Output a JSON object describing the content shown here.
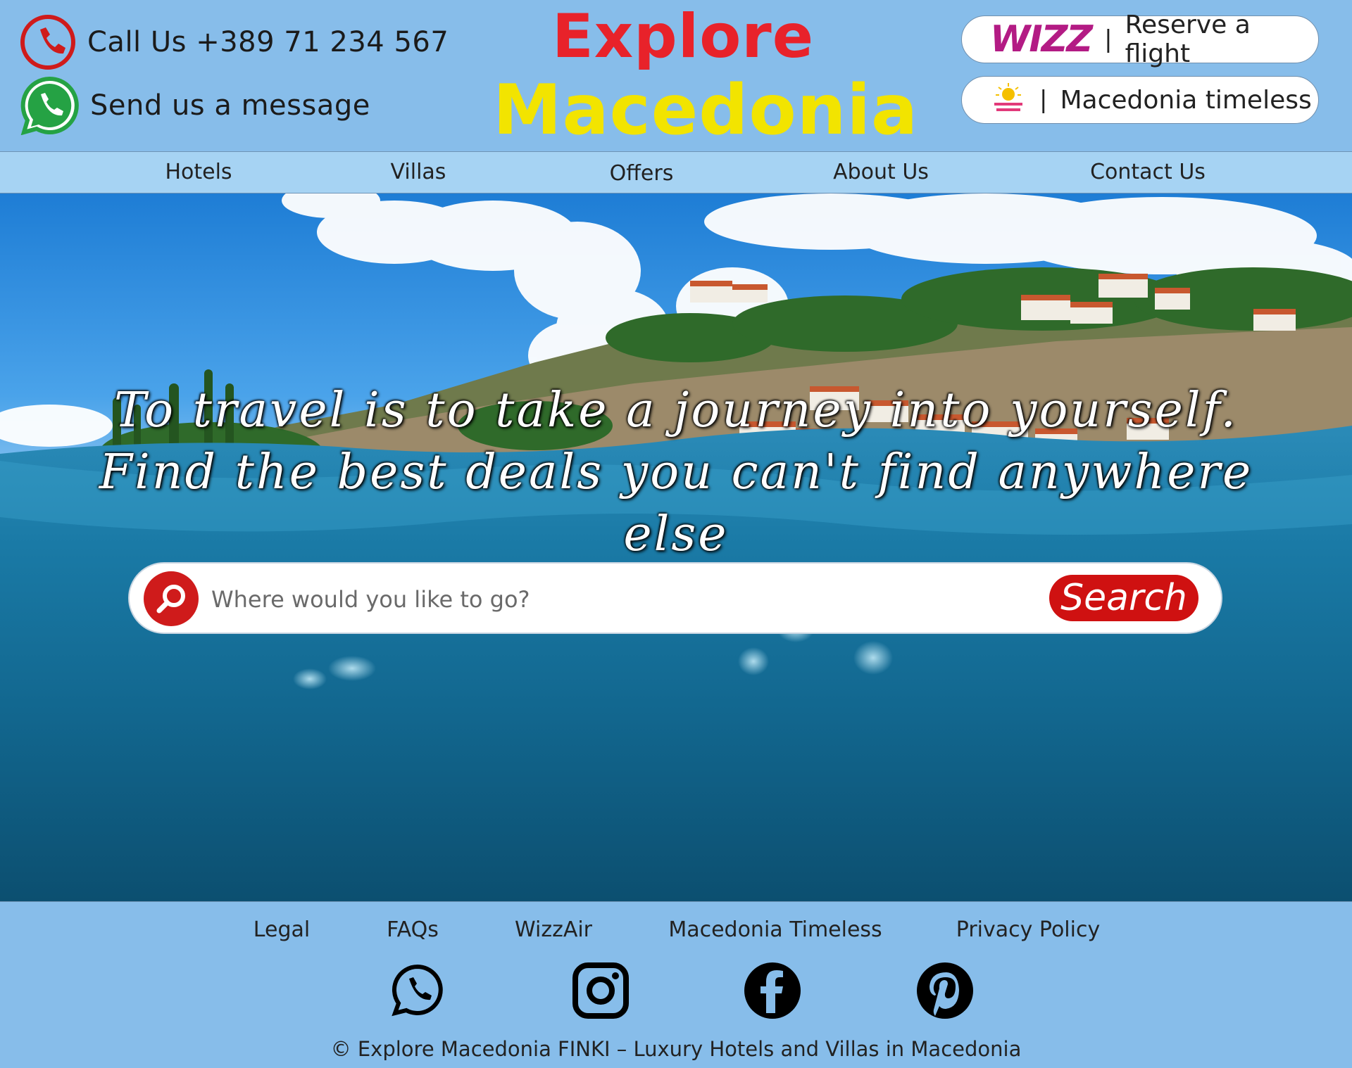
{
  "header": {
    "phone_text": "Call Us +389 71 234 567",
    "message_text": "Send us a message",
    "logo_line1": "Explore",
    "logo_line2": "Macedonia",
    "wizz_logo": "WIZZ",
    "pill_separator": "|",
    "reserve_flight": "Reserve a flight",
    "macedonia_timeless": "Macedonia timeless"
  },
  "nav": {
    "items": [
      {
        "label": "Hotels"
      },
      {
        "label": "Villas"
      },
      {
        "label": "Offers"
      },
      {
        "label": "About Us"
      },
      {
        "label": "Contact Us"
      }
    ]
  },
  "hero": {
    "tagline": "To travel is to take a journey into yourself. Find the best deals you can't find anywhere else",
    "search_placeholder": "Where would you like to go?",
    "search_button": "Search"
  },
  "footer": {
    "links": [
      {
        "label": "Legal"
      },
      {
        "label": "FAQs"
      },
      {
        "label": "WizzAir"
      },
      {
        "label": "Macedonia Timeless"
      },
      {
        "label": "Privacy Policy"
      }
    ],
    "social_icons": [
      "whatsapp-icon",
      "instagram-icon",
      "facebook-icon",
      "pinterest-icon"
    ],
    "copyright": "© Explore Macedonia FINKI – Luxury Hotels and Villas in Macedonia"
  },
  "colors": {
    "header_bg": "#87bdea",
    "nav_bg": "#a6d3f3",
    "accent_red": "#cf1111",
    "logo_red": "#e8222a",
    "logo_yellow": "#f2e400",
    "whatsapp_green": "#25a244"
  }
}
